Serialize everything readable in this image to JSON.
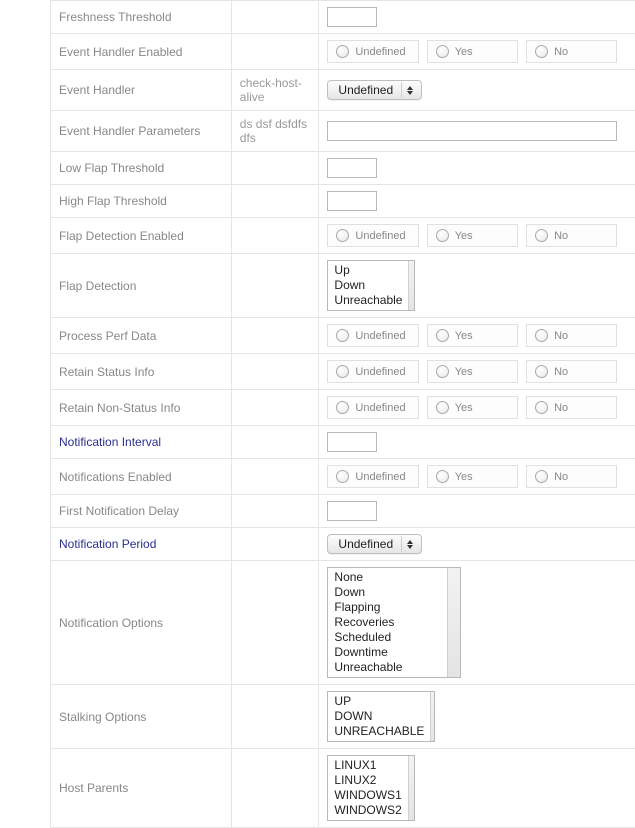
{
  "radio": {
    "undefined": "Undefined",
    "yes": "Yes",
    "no": "No"
  },
  "dropdown_value": "Undefined",
  "labels": {
    "freshness_threshold": "Freshness Threshold",
    "event_handler_enabled": "Event Handler Enabled",
    "event_handler": "Event Handler",
    "event_handler_params": "Event Handler Parameters",
    "low_flap_threshold": "Low Flap Threshold",
    "high_flap_threshold": "High Flap Threshold",
    "flap_detection_enabled": "Flap Detection Enabled",
    "flap_detection": "Flap Detection",
    "process_perf_data": "Process Perf Data",
    "retain_status_info": "Retain Status Info",
    "retain_non_status_info": "Retain Non-Status Info",
    "notification_interval": "Notification Interval",
    "notifications_enabled": "Notifications Enabled",
    "first_notification_delay": "First Notification Delay",
    "notification_period": "Notification Period",
    "notification_options": "Notification Options",
    "stalking_options": "Stalking Options",
    "host_parents": "Host Parents"
  },
  "hints": {
    "event_handler": "check-host-alive",
    "event_handler_params": "ds dsf dsfdfs dfs"
  },
  "lists": {
    "flap_detection": [
      "Up",
      "Down",
      "Unreachable"
    ],
    "notification_options": [
      "None",
      "Down",
      "Flapping",
      "Recoveries",
      "Scheduled Downtime",
      "Unreachable"
    ],
    "stalking_options": [
      "UP",
      "DOWN",
      "UNREACHABLE"
    ],
    "host_parents": [
      "LINUX1",
      "LINUX2",
      "WINDOWS1",
      "WINDOWS2"
    ]
  }
}
